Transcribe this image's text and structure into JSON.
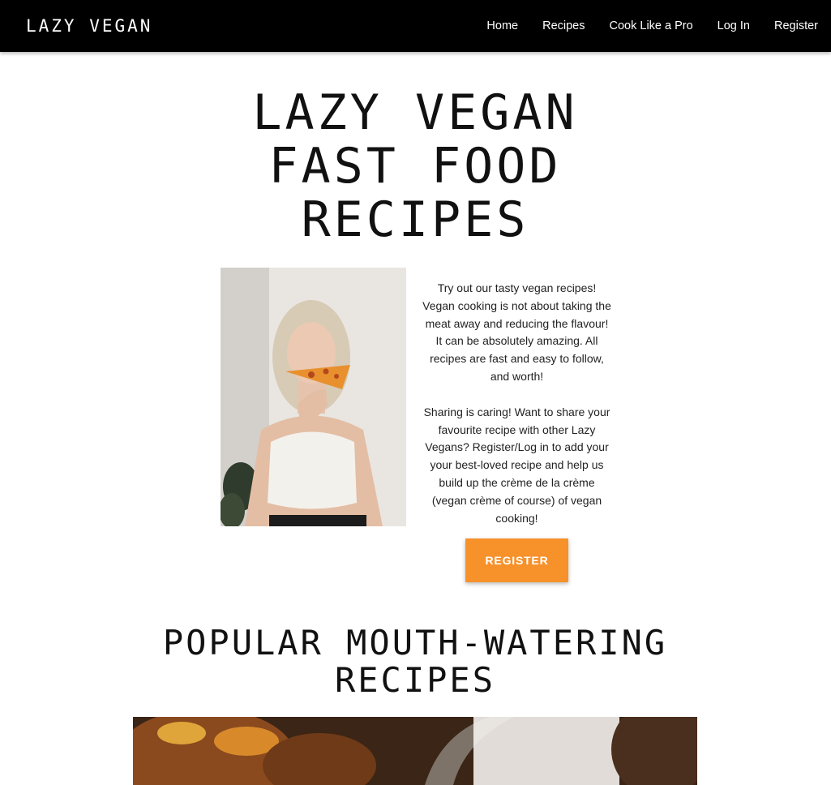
{
  "navbar": {
    "brand": "LAZY VEGAN",
    "links": [
      {
        "label": "Home"
      },
      {
        "label": "Recipes"
      },
      {
        "label": "Cook Like a Pro"
      },
      {
        "label": "Log In"
      },
      {
        "label": "Register"
      }
    ]
  },
  "hero": {
    "title": "LAZY VEGAN FAST FOOD RECIPES",
    "paragraph_1": "Try out our tasty vegan recipes! Vegan cooking is not about taking the meat away and reducing the flavour! It can be absolutely amazing. All recipes are fast and easy to follow, and worth!",
    "paragraph_2": "Sharing is caring! Want to share your favourite recipe with other Lazy Vegans? Register/Log in to add your your best-loved recipe and help us build up the crème de la crème (vegan crème of course) of vegan cooking!",
    "cta_label": "REGISTER"
  },
  "popular": {
    "title": "POPULAR MOUTH-WATERING RECIPES"
  },
  "colors": {
    "navbar_bg": "#000000",
    "accent": "#f7912a",
    "page_bg": "#ffffff"
  }
}
